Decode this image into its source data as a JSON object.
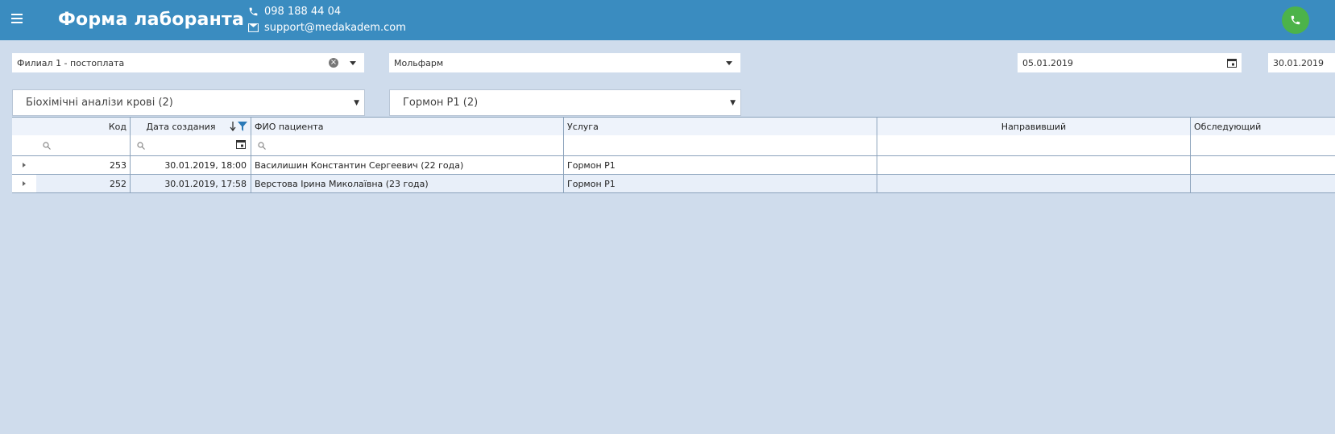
{
  "header": {
    "title": "Форма лаборанта",
    "phone": "098 188 44 04",
    "email": "support@medakadem.com"
  },
  "filters": {
    "branch": "Филиал 1 - постоплата",
    "company": "Мольфарм",
    "date_from": "05.01.2019",
    "date_to": "30.01.2019",
    "analysis_group": "Біохімічні аналізи крові (2)",
    "service": "Гормон P1 (2)"
  },
  "grid": {
    "columns": [
      "Код",
      "Дата создания",
      "ФИО пациента",
      "Услуга",
      "Направивший",
      "Обследующий"
    ],
    "rows": [
      {
        "code": "253",
        "date": "30.01.2019, 18:00",
        "patient": "Василишин Константин Сергеевич (22 года)",
        "service": "Гормон P1",
        "referrer": "",
        "examiner": ""
      },
      {
        "code": "252",
        "date": "30.01.2019, 17:58",
        "patient": "Верстова Ірина Миколаївна (23 года)",
        "service": "Гормон P1",
        "referrer": "",
        "examiner": ""
      }
    ]
  },
  "colors": {
    "header_bg": "#3a8cc0",
    "page_bg": "#cfdcec",
    "call_button": "#4cb34a"
  }
}
